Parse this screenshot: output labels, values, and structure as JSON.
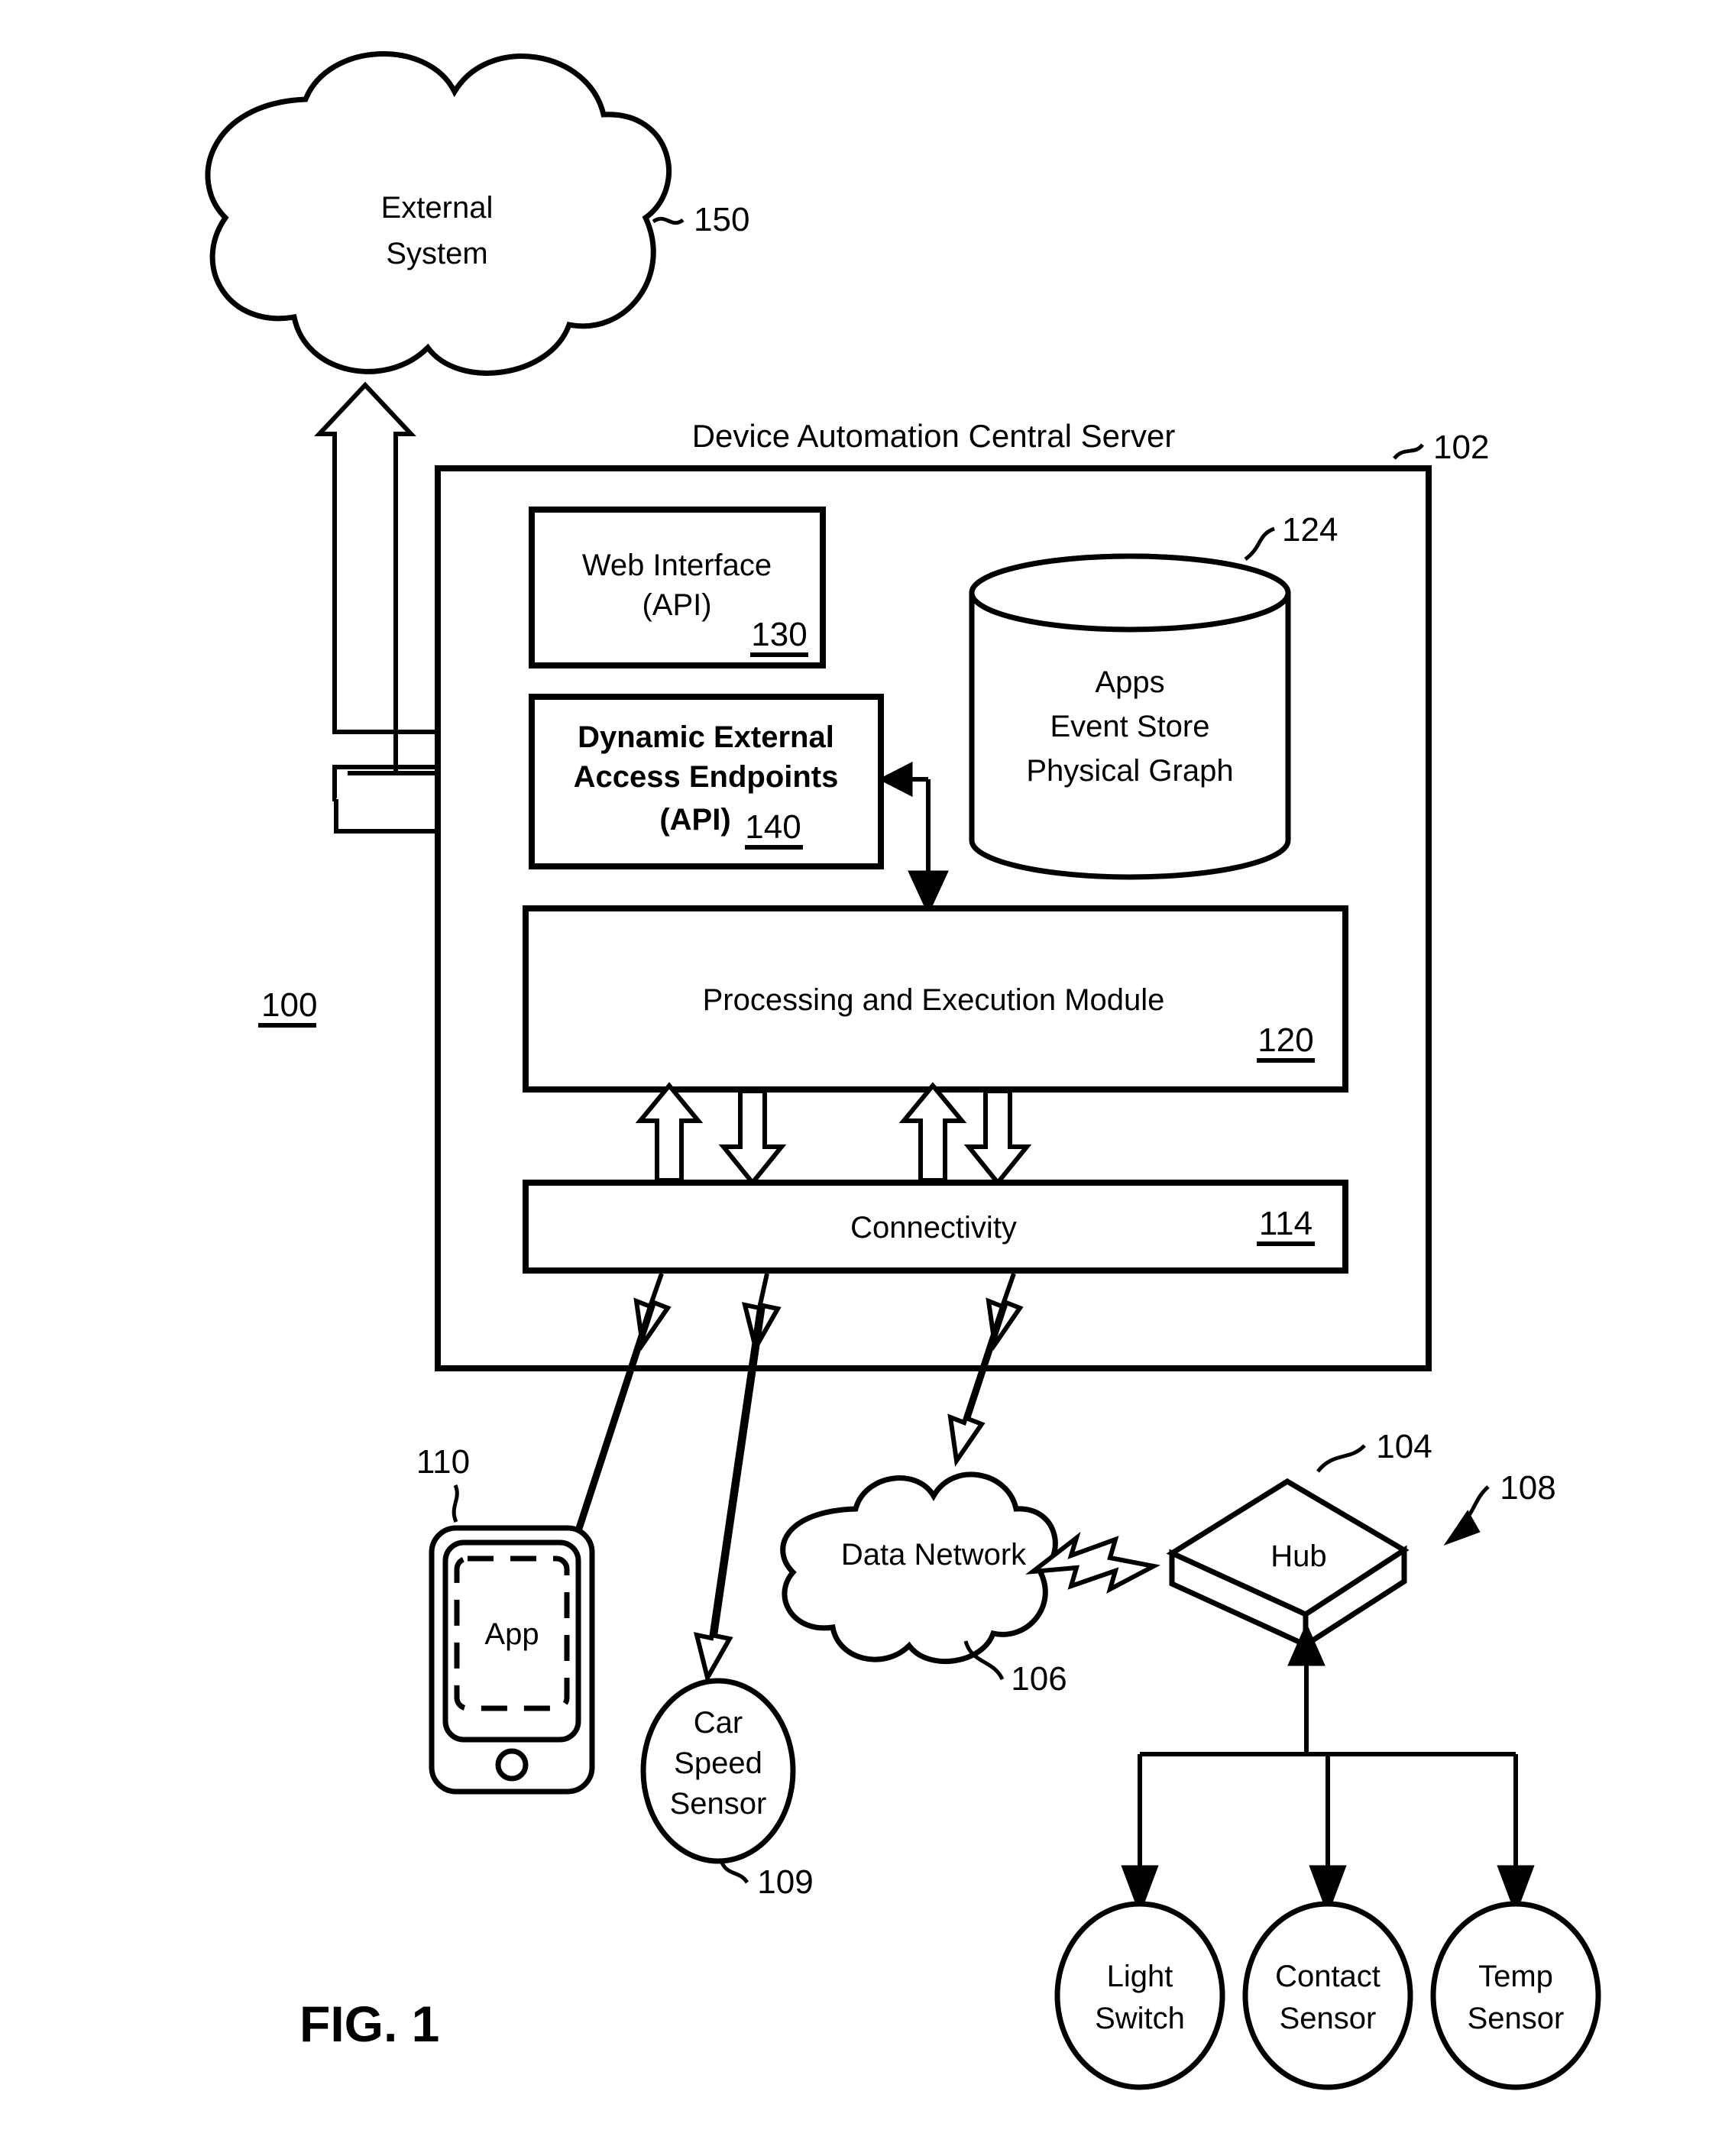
{
  "figure": {
    "caption": "FIG. 1",
    "system_ref": "100"
  },
  "external_system": {
    "line1": "External",
    "line2": "System",
    "ref": "150"
  },
  "server": {
    "title": "Device Automation Central Server",
    "ref": "102",
    "web_interface": {
      "line1": "Web Interface",
      "line2": "(API)",
      "ref": "130"
    },
    "endpoints": {
      "line1": "Dynamic External",
      "line2": "Access Endpoints",
      "line3": "(API)",
      "ref": "140"
    },
    "datastore": {
      "line1": "Apps",
      "line2": "Event Store",
      "line3": "Physical Graph",
      "ref": "124"
    },
    "processing": {
      "label": "Processing and Execution Module",
      "ref": "120"
    },
    "connectivity": {
      "label": "Connectivity",
      "ref": "114"
    }
  },
  "devices": {
    "phone": {
      "app_label": "App",
      "ref": "110"
    },
    "car_speed_sensor": {
      "line1": "Car",
      "line2": "Speed",
      "line3": "Sensor",
      "ref": "109"
    },
    "data_network": {
      "label": "Data Network",
      "ref": "106"
    },
    "hub": {
      "label": "Hub",
      "ref": "104"
    },
    "sensor_group_ref": "108",
    "light_switch": {
      "line1": "Light",
      "line2": "Switch"
    },
    "contact_sensor": {
      "line1": "Contact",
      "line2": "Sensor"
    },
    "temp_sensor": {
      "line1": "Temp",
      "line2": "Sensor"
    }
  }
}
